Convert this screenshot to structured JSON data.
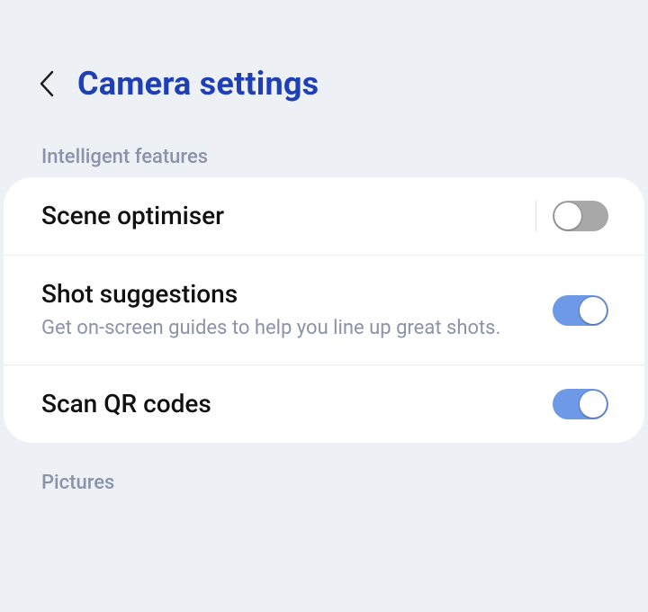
{
  "header": {
    "title": "Camera settings"
  },
  "sections": {
    "intelligent_features": {
      "label": "Intelligent features",
      "items": {
        "scene_optimiser": {
          "title": "Scene optimiser",
          "enabled": false
        },
        "shot_suggestions": {
          "title": "Shot suggestions",
          "subtitle": "Get on-screen guides to help you line up great shots.",
          "enabled": true
        },
        "scan_qr": {
          "title": "Scan QR codes",
          "enabled": true
        }
      }
    },
    "pictures": {
      "label": "Pictures"
    }
  }
}
